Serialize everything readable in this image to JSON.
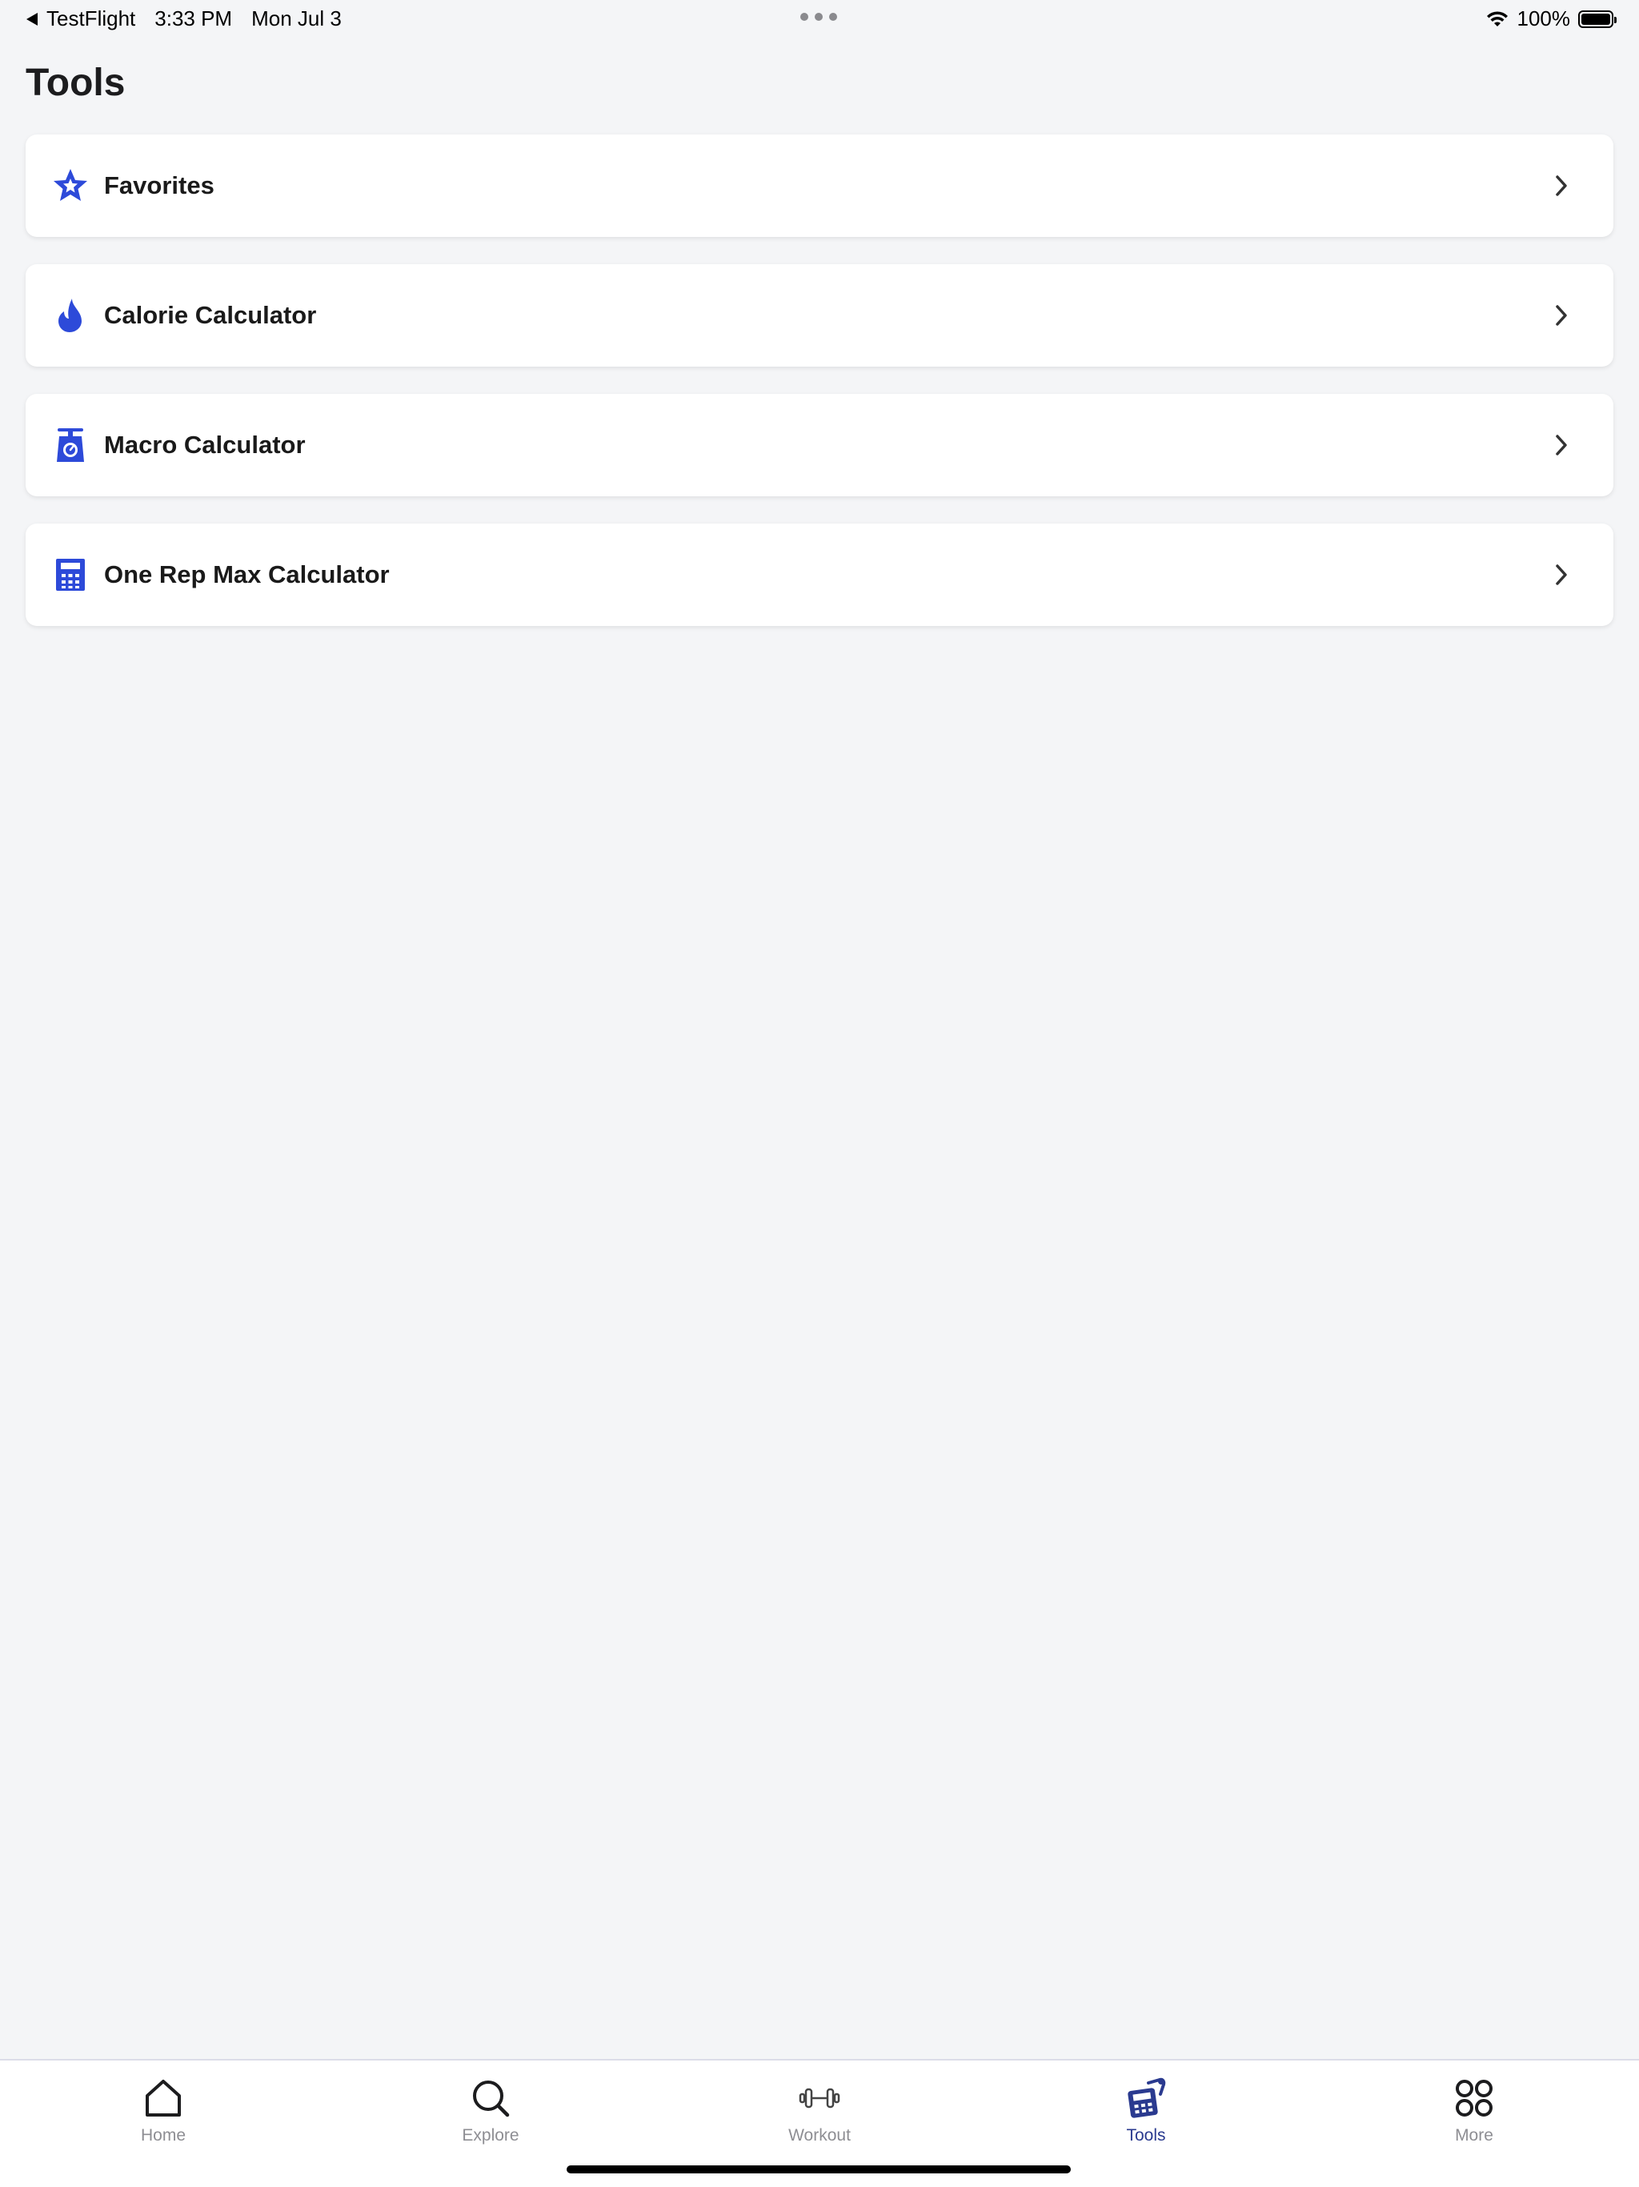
{
  "status_bar": {
    "back_app": "TestFlight",
    "time": "3:33 PM",
    "date": "Mon Jul 3",
    "battery": "100%",
    "battery_level": 1.0
  },
  "page": {
    "title": "Tools"
  },
  "accent_color": "#2d4ad9",
  "tools": [
    {
      "label": "Favorites",
      "icon": "star-icon"
    },
    {
      "label": "Calorie Calculator",
      "icon": "flame-icon"
    },
    {
      "label": "Macro Calculator",
      "icon": "scale-icon"
    },
    {
      "label": "One Rep Max Calculator",
      "icon": "calculator-icon"
    }
  ],
  "tab_bar": {
    "active": "Tools",
    "active_color": "#2a3a8f",
    "tabs": [
      {
        "label": "Home",
        "icon": "home-icon"
      },
      {
        "label": "Explore",
        "icon": "search-icon"
      },
      {
        "label": "Workout",
        "icon": "dumbbell-icon"
      },
      {
        "label": "Tools",
        "icon": "tools-icon"
      },
      {
        "label": "More",
        "icon": "grid-icon"
      }
    ]
  }
}
